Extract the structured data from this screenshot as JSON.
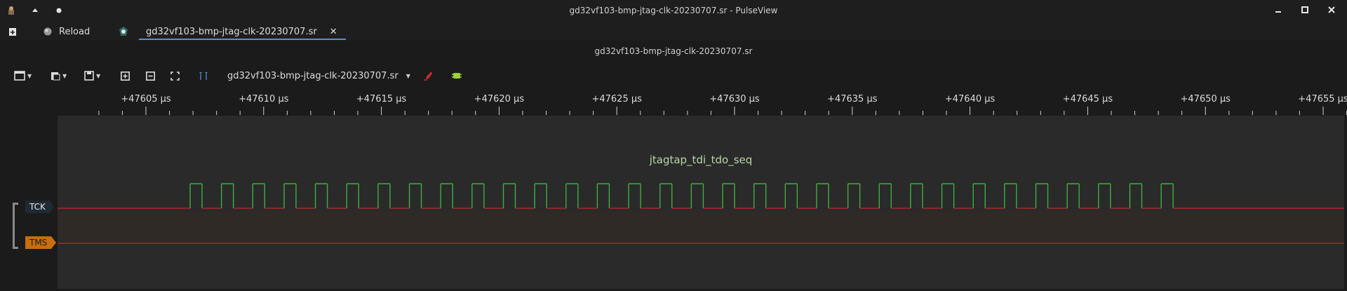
{
  "window": {
    "title": "gd32vf103-bmp-jtag-clk-20230707.sr - PulseView"
  },
  "tabs": {
    "reload_label": "Reload",
    "active_tab_label": "gd32vf103-bmp-jtag-clk-20230707.sr",
    "close_glyph": "✕"
  },
  "document": {
    "title": "gd32vf103-bmp-jtag-clk-20230707.sr"
  },
  "toolbar": {
    "file_selector_label": "gd32vf103-bmp-jtag-clk-20230707.sr"
  },
  "ruler": {
    "ticks": [
      "+47605 µs",
      "+47610 µs",
      "+47615 µs",
      "+47620 µs",
      "+47625 µs",
      "+47630 µs",
      "+47635 µs",
      "+47640 µs",
      "+47645 µs",
      "+47650 µs",
      "+47655 µs"
    ]
  },
  "trace": {
    "decoder_label": "jtagtap_tdi_tdo_seq",
    "channels": [
      {
        "name": "TCK",
        "color": "#1f2a33"
      },
      {
        "name": "TMS",
        "color": "#c86e0c"
      }
    ],
    "tck_pulse_count": 32,
    "colors": {
      "high": "#3fae3f",
      "low": "#b02424",
      "background": "#2a2a2a"
    }
  }
}
